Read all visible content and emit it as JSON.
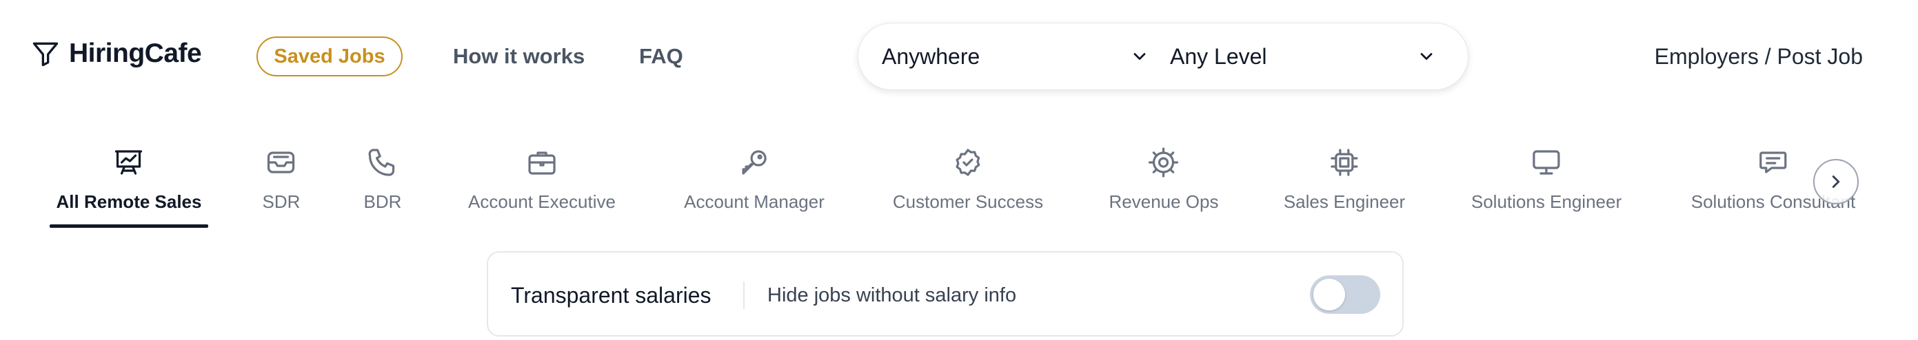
{
  "header": {
    "logo_text": "HiringCafe",
    "saved_jobs_label": "Saved Jobs",
    "nav": [
      "How it works",
      "FAQ"
    ],
    "location_select": "Anywhere",
    "level_select": "Any Level",
    "employers_link": "Employers / Post Job"
  },
  "categories": [
    {
      "label": "All Remote Sales",
      "icon": "presentation-chart-icon",
      "active": true
    },
    {
      "label": "SDR",
      "icon": "inbox-icon"
    },
    {
      "label": "BDR",
      "icon": "phone-icon"
    },
    {
      "label": "Account Executive",
      "icon": "briefcase-icon"
    },
    {
      "label": "Account Manager",
      "icon": "key-icon"
    },
    {
      "label": "Customer Success",
      "icon": "badge-check-icon"
    },
    {
      "label": "Revenue Ops",
      "icon": "cog-icon"
    },
    {
      "label": "Sales Engineer",
      "icon": "chip-icon"
    },
    {
      "label": "Solutions Engineer",
      "icon": "monitor-icon"
    },
    {
      "label": "Solutions Consultant",
      "icon": "chat-icon"
    }
  ],
  "salary_filter": {
    "title": "Transparent salaries",
    "description": "Hide jobs without salary info",
    "enabled": false
  },
  "colors": {
    "accent": "#c8901c",
    "toggle_off": "#cbd5e1",
    "muted_text": "#6b7280"
  }
}
